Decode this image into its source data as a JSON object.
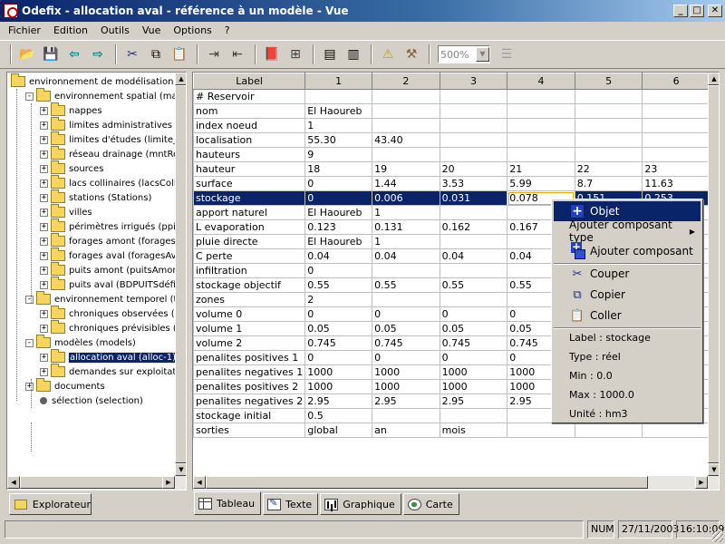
{
  "window": {
    "title": "Odefix - allocation aval - référence à un modèle - Vue"
  },
  "menubar": {
    "items": [
      "Fichier",
      "Edition",
      "Outils",
      "Vue",
      "Options",
      "?"
    ]
  },
  "toolbar": {
    "zoom_value": "500%"
  },
  "explorer": {
    "nodes": [
      {
        "label": "environnement de modélisation",
        "type": "folder",
        "expander": ""
      },
      {
        "label": "environnement spatial (map)",
        "type": "folder",
        "expander": "-"
      },
      {
        "label": "nappes",
        "type": "folder",
        "expander": "+"
      },
      {
        "label": "limites administratives (Sec",
        "type": "folder",
        "expander": "+"
      },
      {
        "label": "limites d'études (limite_etud",
        "type": "folder",
        "expander": "+"
      },
      {
        "label": "réseau drainage (mntResea",
        "type": "folder",
        "expander": "+"
      },
      {
        "label": "sources",
        "type": "folder",
        "expander": "+"
      },
      {
        "label": "lacs collinaires (lacsCollina",
        "type": "folder",
        "expander": "+"
      },
      {
        "label": "stations (Stations)",
        "type": "folder",
        "expander": "+"
      },
      {
        "label": "villes",
        "type": "folder",
        "expander": "+"
      },
      {
        "label": "périmètres irrigués (ppi)",
        "type": "folder",
        "expander": "+"
      },
      {
        "label": "forages amont (foragesAmo",
        "type": "folder",
        "expander": "+"
      },
      {
        "label": "forages aval (foragesAval)",
        "type": "folder",
        "expander": "+"
      },
      {
        "label": "puits amont (puitsAmont)",
        "type": "folder",
        "expander": "+"
      },
      {
        "label": "puits aval (BDPUITSdéfiniti",
        "type": "folder",
        "expander": "+"
      },
      {
        "label": "environnement temporel (time)",
        "type": "folder",
        "expander": "-"
      },
      {
        "label": "chroniques observées (Obse",
        "type": "folder",
        "expander": "+"
      },
      {
        "label": "chroniques prévisibles (Prec",
        "type": "folder",
        "expander": "+"
      },
      {
        "label": "modèles (models)",
        "type": "folder",
        "expander": "-"
      },
      {
        "label": "allocation aval (alloc-1)",
        "type": "folder",
        "expander": "+",
        "selected": true
      },
      {
        "label": "demandes sur exploitations",
        "type": "folder",
        "expander": "+"
      },
      {
        "label": "documents",
        "type": "folder",
        "expander": "+"
      },
      {
        "label": "sélection (selection)",
        "type": "dot",
        "expander": ""
      }
    ],
    "tab_label": "Explorateur"
  },
  "table": {
    "headers": [
      "Label",
      "1",
      "2",
      "3",
      "4",
      "5",
      "6"
    ],
    "rows": [
      [
        "# Reservoir",
        "",
        "",
        "",
        "",
        "",
        ""
      ],
      [
        "nom",
        "El Haoureb",
        "",
        "",
        "",
        "",
        ""
      ],
      [
        "index noeud",
        "1",
        "",
        "",
        "",
        "",
        ""
      ],
      [
        "localisation",
        "55.30",
        "43.40",
        "",
        "",
        "",
        ""
      ],
      [
        "hauteurs",
        "9",
        "",
        "",
        "",
        "",
        ""
      ],
      [
        "hauteur",
        "18",
        "19",
        "20",
        "21",
        "22",
        "23"
      ],
      [
        "surface",
        "0",
        "1.44",
        "3.53",
        "5.99",
        "8.7",
        "11.63"
      ],
      [
        "stockage",
        "0",
        "0.006",
        "0.031",
        "0.078",
        "0.151",
        "0.253"
      ],
      [
        "apport naturel",
        "El Haoureb",
        "1",
        "",
        "",
        "",
        ""
      ],
      [
        "L evaporation",
        "0.123",
        "0.131",
        "0.162",
        "0.167",
        "",
        ""
      ],
      [
        "pluie directe",
        "El Haoureb",
        "1",
        "",
        "",
        "",
        ""
      ],
      [
        "C perte",
        "0.04",
        "0.04",
        "0.04",
        "0.04",
        "",
        ""
      ],
      [
        "infiltration",
        "0",
        "",
        "",
        "",
        "",
        ""
      ],
      [
        "stockage objectif",
        "0.55",
        "0.55",
        "0.55",
        "0.55",
        "",
        ""
      ],
      [
        "zones",
        "2",
        "",
        "",
        "",
        "",
        ""
      ],
      [
        "volume 0",
        "0",
        "0",
        "0",
        "0",
        "",
        ""
      ],
      [
        "volume 1",
        "0.05",
        "0.05",
        "0.05",
        "0.05",
        "",
        ""
      ],
      [
        "volume 2",
        "0.745",
        "0.745",
        "0.745",
        "0.745",
        "",
        ""
      ],
      [
        "penalites positives 1",
        "0",
        "0",
        "0",
        "0",
        "",
        ""
      ],
      [
        "penalites negatives 1",
        "1000",
        "1000",
        "1000",
        "1000",
        "",
        ""
      ],
      [
        "penalites positives 2",
        "1000",
        "1000",
        "1000",
        "1000",
        "",
        ""
      ],
      [
        "penalites negatives 2",
        "2.95",
        "2.95",
        "2.95",
        "2.95",
        "",
        ""
      ],
      [
        "stockage initial",
        "0.5",
        "",
        "",
        "",
        "",
        ""
      ],
      [
        "sorties",
        "global",
        "an",
        "mois",
        "",
        "",
        ""
      ]
    ]
  },
  "view_tabs": [
    "Tableau",
    "Texte",
    "Graphique",
    "Carte"
  ],
  "context_menu": {
    "objet": "Objet",
    "ajouter_type": "Ajouter composant type",
    "ajouter": "Ajouter composant",
    "couper": "Couper",
    "copier": "Copier",
    "coller": "Coller",
    "info": [
      "Label : stockage",
      "Type : réel",
      "Min : 0.0",
      "Max : 1000.0",
      "Unité : hm3"
    ]
  },
  "statusbar": {
    "num": "NUM",
    "date": "27/11/2003",
    "time": "16:10:09"
  }
}
